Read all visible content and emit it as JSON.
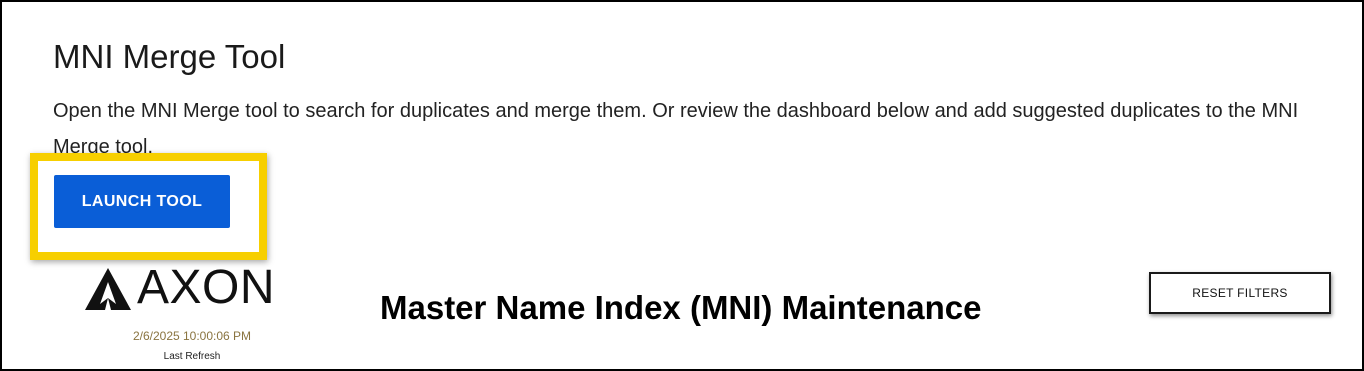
{
  "header": {
    "title": "MNI Merge Tool",
    "description": "Open the MNI Merge tool to search for duplicates and merge them. Or review the dashboard below and add suggested duplicates to the MNI Merge tool."
  },
  "actions": {
    "launch_label": "LAUNCH TOOL",
    "reset_label": "RESET FILTERS"
  },
  "branding": {
    "logo_text": "AXON",
    "logo_icon": "axon-delta-icon"
  },
  "refresh": {
    "timestamp": "2/6/2025 10:00:06 PM",
    "label": "Last Refresh"
  },
  "dashboard": {
    "title": "Master Name Index (MNI) Maintenance"
  },
  "colors": {
    "primary_button": "#0a5ed7",
    "highlight": "#f7cf00",
    "refresh_text": "#8a7440"
  }
}
